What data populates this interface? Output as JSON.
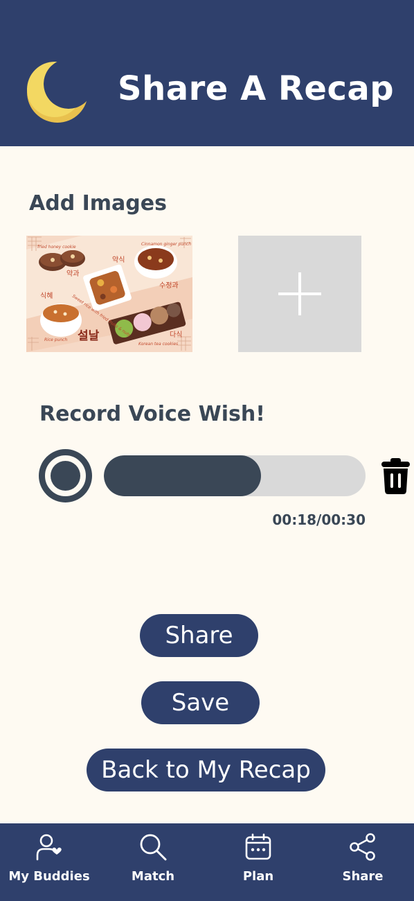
{
  "header": {
    "title": "Share A Recap",
    "logo_icon": "crescent-moon-icon"
  },
  "images_section": {
    "title": "Add Images",
    "image_text": {
      "cookie_en": "fried honey cookie",
      "cookie_ko": "약과",
      "punch_en": "Cinnamon ginger punch",
      "punch_ko": "수정과",
      "rice_en": "Sweet rice with fried fruits & nuts",
      "rice_ko": "약식",
      "sikhye_ko": "식혜",
      "sikhye_en": "Rice punch",
      "tea_en": "Korean tea cookies",
      "tea_ko": "다식",
      "seollal": "설날"
    },
    "add_button_icon": "plus-icon"
  },
  "voice_section": {
    "title": "Record Voice Wish!",
    "record_icon": "record-icon",
    "delete_icon": "trash-icon",
    "progress": 0.6,
    "time": "00:18/00:30"
  },
  "buttons": {
    "share_label": "Share",
    "save_label": "Save",
    "back_label": "Back to My Recap"
  },
  "nav": {
    "items": [
      {
        "label": "My Buddies",
        "icon": "person-heart-icon"
      },
      {
        "label": "Match",
        "icon": "search-icon"
      },
      {
        "label": "Plan",
        "icon": "calendar-icon"
      },
      {
        "label": "Share",
        "icon": "share-icon"
      }
    ]
  },
  "colors": {
    "primary": "#2f406c",
    "dark_slate": "#3a4756",
    "background": "#fefaf2",
    "placeholder_gray": "#d9d9d9",
    "moon_yellow": "#f2d562",
    "moon_shadow": "#e8c24c"
  }
}
